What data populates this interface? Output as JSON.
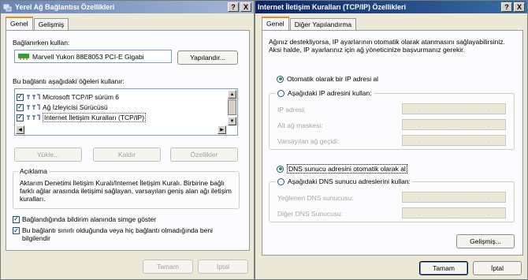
{
  "left_window": {
    "title": "Yerel Ağ Bağlantısı Özellikleri",
    "title_buttons": [
      "?",
      "X"
    ],
    "tabs": [
      "Genel",
      "Gelişmiş"
    ],
    "connect_using_label": "Bağlanırken kullan:",
    "adapter_name": "Marvell Yukon 88E8053 PCI-E Gigabi",
    "configure_button": "Yapılandır...",
    "components_label": "Bu bağlantı aşağıdaki öğeleri kullanır:",
    "components": [
      {
        "label": "Microsoft TCP/IP sürüm 6",
        "checked": true,
        "selected": false
      },
      {
        "label": "Ağ İzleyicisi Sürücüsü",
        "checked": true,
        "selected": false
      },
      {
        "label": "Internet İletişim Kuralları (TCP/IP)",
        "checked": true,
        "selected": true
      }
    ],
    "install_button": "Yükle...",
    "uninstall_button": "Kaldır",
    "properties_button": "Özellikler",
    "description_legend": "Açıklama",
    "description_text": "Aktarım Denetimi İletişim Kuralı/Internet İletişim Kuralı. Birbirine bağlı farklı ağlar arasında iletişimi sağlayan, varsayılan geniş alan ağı iletişim kuralları.",
    "show_icon_label": "Bağlandığında bildirim alanında simge göster",
    "show_icon_checked": true,
    "notify_label": "Bu bağlantı sınırlı olduğunda veya hiç bağlantı olmadığında beni bilgilendir",
    "notify_checked": true,
    "ok_button": "Tamam",
    "cancel_button": "İptal"
  },
  "right_window": {
    "title": "Internet İletişim Kuralları (TCP/IP) Özellikleri",
    "title_buttons": [
      "?",
      "X"
    ],
    "tabs": [
      "Genel",
      "Diğer Yapılandırma"
    ],
    "intro_text": "Ağınız destekliyorsa, IP ayarlarının otomatik olarak atanmasını sağlayabilirsiniz. Aksi halde, IP ayarlarınız için ağ yöneticinize başvurmanız gerekir.",
    "ip_auto_label": "Otomatik olarak bir IP adresi al",
    "ip_auto_selected": true,
    "ip_manual_label": "Aşağıdaki IP adresini kullan:",
    "ip_address_label": "IP adresi:",
    "subnet_label": "Alt ağ maskesi:",
    "gateway_label": "Varsayılan ağ geçidi:",
    "dns_auto_label": "DNS sunucu adresini otomatik olarak al",
    "dns_auto_selected": true,
    "dns_manual_label": "Aşağıdaki DNS sunucu adreslerini kullan:",
    "preferred_dns_label": "Yeğlenen DNS sunucusu:",
    "alternate_dns_label": "Diğer DNS Sunucusu:",
    "advanced_button": "Gelişmiş...",
    "ok_button": "Tamam",
    "cancel_button": "İptal"
  }
}
